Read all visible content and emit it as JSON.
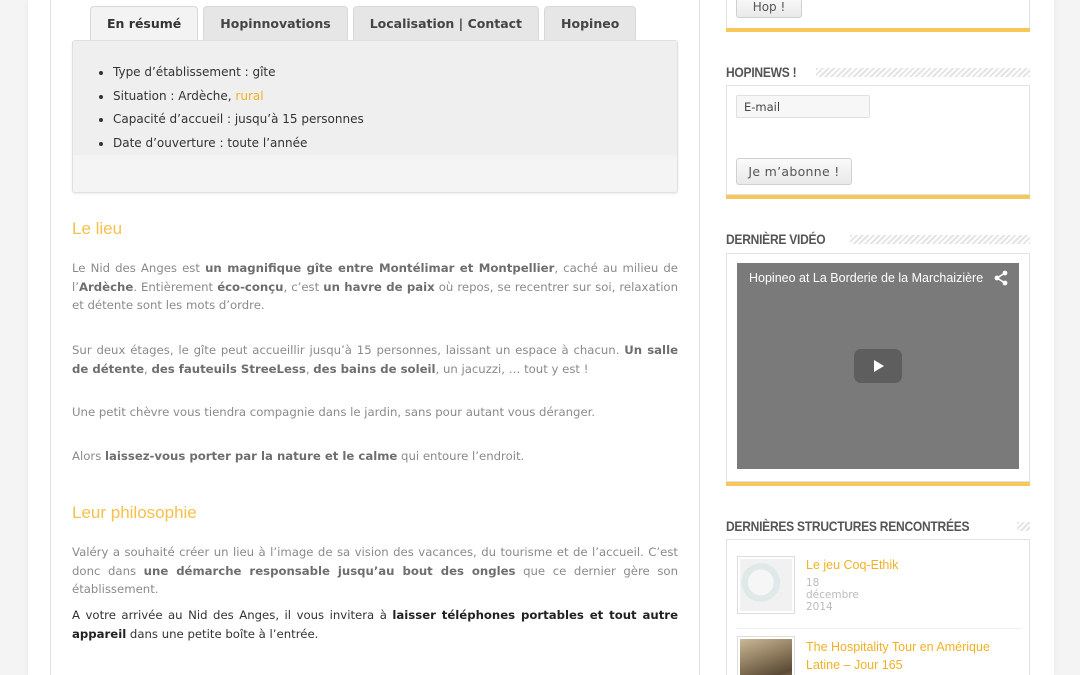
{
  "tabs": [
    {
      "label": "En résumé"
    },
    {
      "label": "Hopinnovations"
    },
    {
      "label": "Localisation | Contact"
    },
    {
      "label": "Hopineo"
    }
  ],
  "summary": {
    "items": [
      {
        "text": "Type d’établissement : gîte"
      },
      {
        "prefix": "Situation : Ardèche, ",
        "link": "rural"
      },
      {
        "text": "Capacité d’accueil : jusqu’à 15 personnes"
      },
      {
        "text": "Date d’ouverture : toute l’année"
      }
    ]
  },
  "article": {
    "heading1": "Le lieu",
    "p1": {
      "t1": "Le Nid des Anges est ",
      "b1": "un magnifique gîte entre Montélimar et Montpellier",
      "t2": ", caché au milieu de l’",
      "b2": "Ardèche",
      "t3": ". Entièrement ",
      "b3": "éco-conçu",
      "t4": ", c’est ",
      "b4": "un havre de paix",
      "t5": " où repos, se recentrer sur soi, relaxation et détente sont les mots d’ordre."
    },
    "p2": {
      "t1": "Sur deux étages, le gîte peut accueillir jusqu’à 15 personnes, laissant un espace à chacun. ",
      "b1": "Un salle de détente",
      "t2": ", ",
      "b2": "des fauteuils StreeLess",
      "t3": ", ",
      "b3": "des bains de soleil",
      "t4": ", un jacuzzi, … tout y est !"
    },
    "p3": "Une petit chèvre vous tiendra compagnie dans le jardin, sans pour autant vous déranger.",
    "p4": {
      "t1": "Alors ",
      "b1": "laissez-vous porter par la nature et le calme",
      "t2": " qui entoure l’endroit."
    },
    "heading2": "Leur philosophie",
    "p5": {
      "t1": "Valéry a souhaité créer un lieu à l’image de sa vision des vacances, du tourisme et de l’accueil. C’est donc dans ",
      "b1": "une démarche responsable jusqu’au bout des ongles",
      "t2": " que ce dernier gère son établissement."
    },
    "p6": {
      "t1": "A votre arrivée au Nid des Anges, il vous invitera à ",
      "b1": "laisser téléphones portables et tout autre appareil",
      "t2": " dans une petite boîte à l’entrée."
    }
  },
  "sidebar": {
    "top_button": "Hop !",
    "newsletter": {
      "title": "HOPINEWS !",
      "email_placeholder": "E-mail",
      "subscribe": "Je m’abonne !"
    },
    "video": {
      "title": "DERNIÈRE VIDÉO",
      "video_title": "Hopineo at La Borderie de la Marchaizière"
    },
    "structures": {
      "title": "DERNIÈRES STRUCTURES RENCONTRÉES",
      "posts": [
        {
          "title": "Le jeu Coq-Ethik",
          "date": "18 décembre 2014"
        },
        {
          "title": "The Hospitality Tour en Amérique Latine – Jour 165"
        }
      ]
    }
  },
  "colors": {
    "accent": "#f2b124",
    "heading": "#f7c04a",
    "widget_bar": "#f8c75a"
  }
}
